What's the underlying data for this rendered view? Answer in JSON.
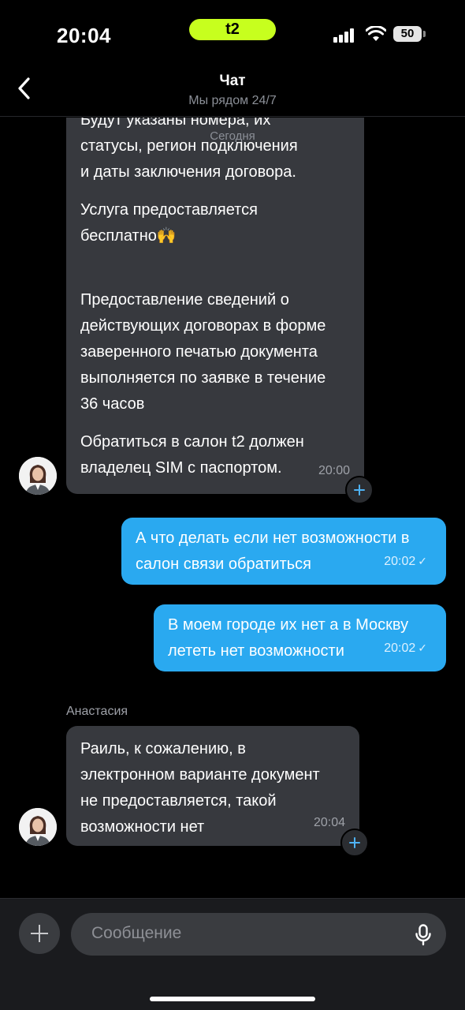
{
  "status_bar": {
    "time": "20:04",
    "carrier": "t2",
    "battery": "50",
    "icons": [
      "signal-icon",
      "wifi-icon",
      "battery-icon"
    ]
  },
  "header": {
    "title": "Чат",
    "subtitle": "Мы рядом 24/7",
    "date_separator": "Сегодня"
  },
  "messages": [
    {
      "direction": "incoming",
      "lines": [
        "Будут указаны номера, их",
        "статусы, регион подключения",
        "и даты заключения договора.",
        "Услуга предоставляется",
        "бесплатно🙌",
        "Предоставление сведений о",
        "действующих договорах в форме",
        "заверенного печатью документа",
        "выполняется по заявке в течение",
        "36 часов",
        "Обратиться в салон t2 должен",
        "владелец SIM с паспортом."
      ],
      "time": "20:00"
    },
    {
      "direction": "outgoing",
      "lines": [
        "А что делать если нет возможности в",
        "салон связи обратиться"
      ],
      "time": "20:02",
      "status": "✓"
    },
    {
      "direction": "outgoing",
      "lines": [
        "В моем городе их нет а в Москву",
        "лететь нет возможности"
      ],
      "time": "20:02",
      "status": "✓"
    },
    {
      "direction": "incoming",
      "sender": "Анастасия",
      "lines": [
        "Раиль, к сожалению, в",
        "электронном варианте документ",
        "не предоставляется, такой",
        "возможности нет"
      ],
      "time": "20:04"
    }
  ],
  "composer": {
    "placeholder": "Сообщение"
  },
  "colors": {
    "background": "#000000",
    "incoming_bubble": "#37393e",
    "outgoing_bubble": "#2aa9f0",
    "carrier_accent": "#c7ff1e",
    "react_plus": "#4fb3f5"
  }
}
